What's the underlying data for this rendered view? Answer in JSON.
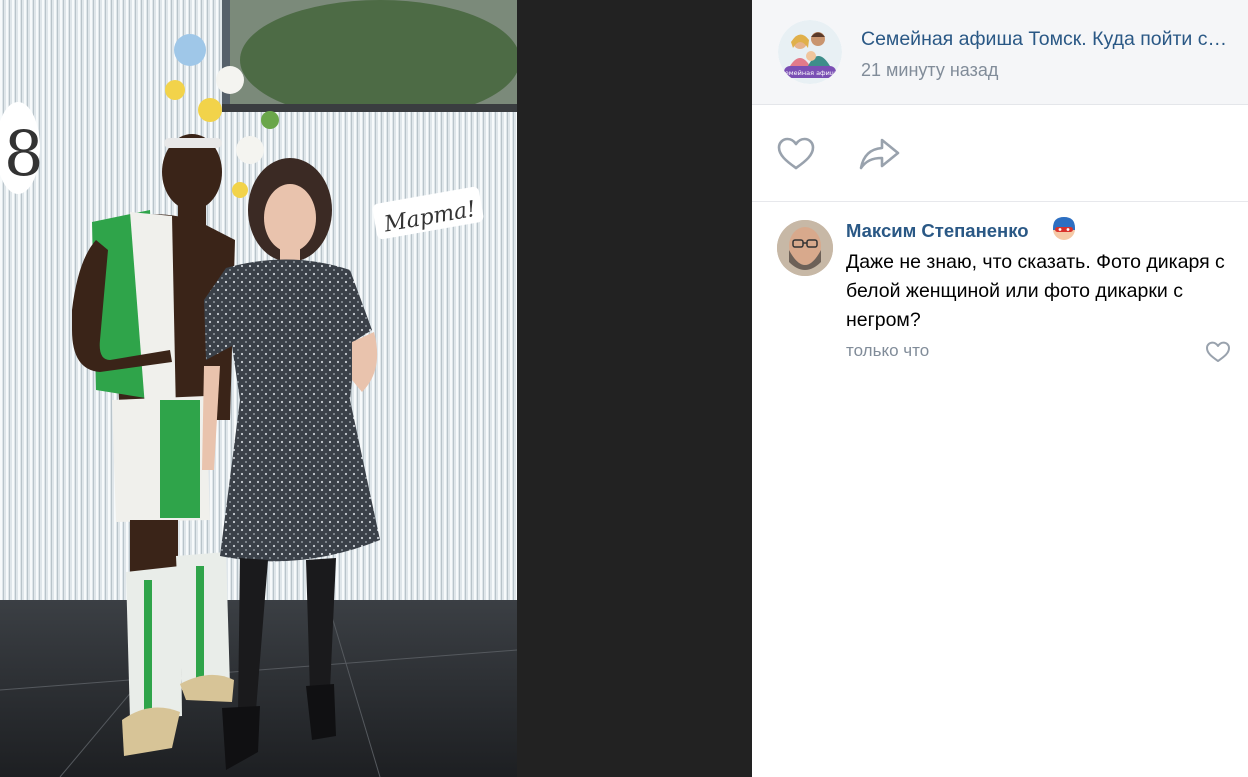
{
  "photo": {
    "icon": "photo-image",
    "sign_text": "Марта!",
    "number_text": "8"
  },
  "post": {
    "community_name": "Семейная афиша Томск. Куда пойти с детьми",
    "time": "21 минуту назад",
    "avatar_caption": "Семейная афиша"
  },
  "actions": {
    "like_icon": "heart-icon",
    "share_icon": "share-arrow-icon"
  },
  "comment": {
    "author": "Максим Степаненко",
    "text": "Даже не знаю, что сказать. Фото дикаря с белой женщиной или фото дикарки с негром?",
    "time": "только что",
    "badge_icon": "superhero-emoji-icon"
  },
  "colors": {
    "link": "#2a5885",
    "secondary": "#818c99",
    "viewer_bg": "#222222",
    "header_bg": "#f5f6f8"
  }
}
